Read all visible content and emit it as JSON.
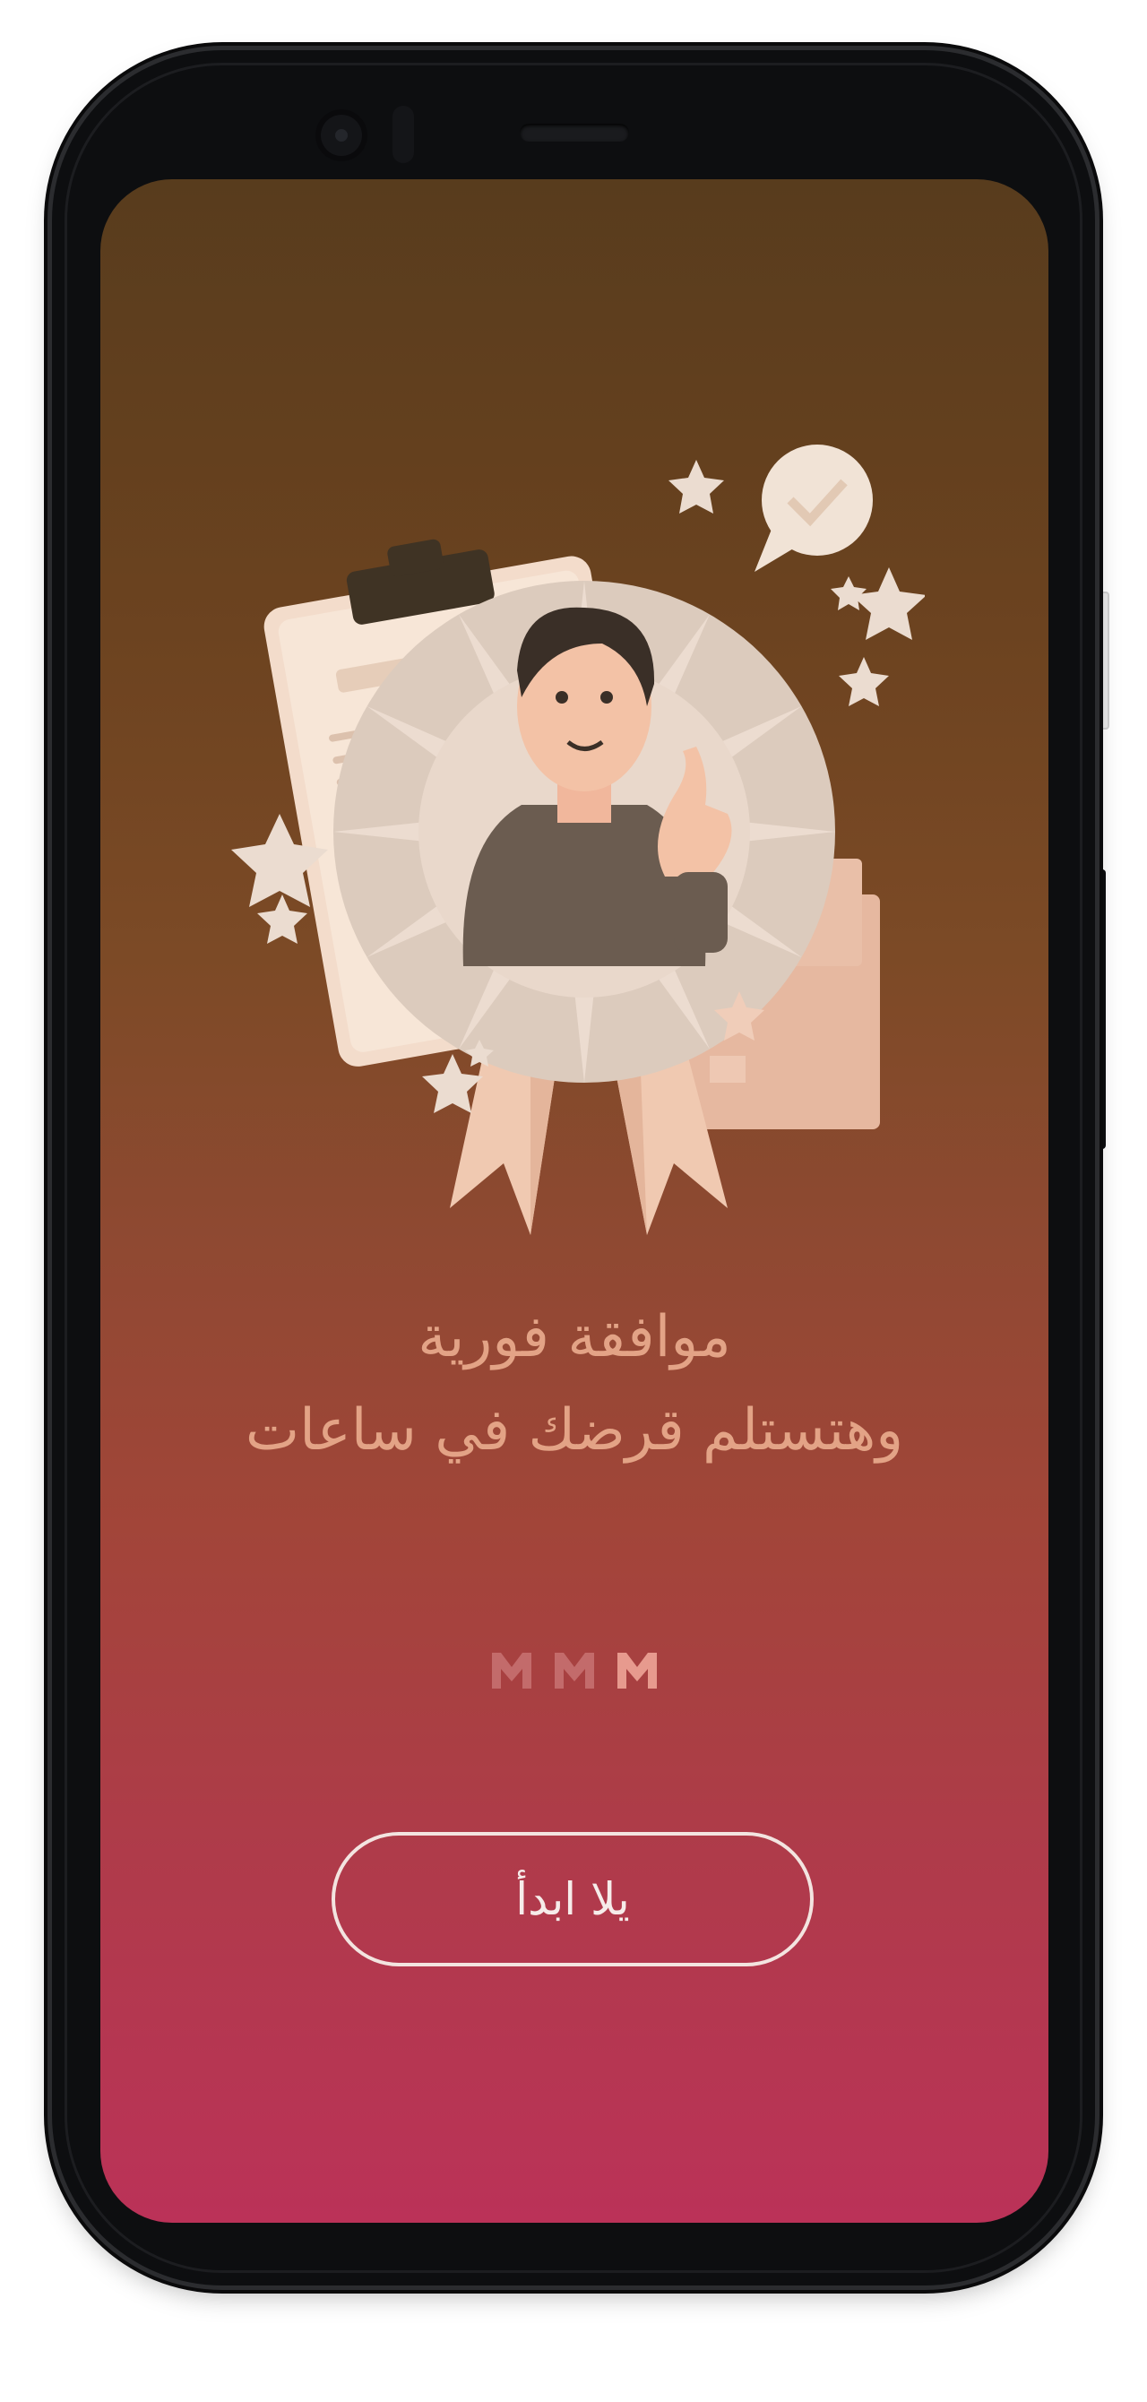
{
  "device": {
    "frame": "phone",
    "colors": {
      "gradient_top": "#583c1d",
      "gradient_bottom": "#bb3258",
      "headline": "#e3a386",
      "button_border": "#f3e4e0"
    }
  },
  "onboarding": {
    "illustration": "approved-man-thumbs-up-badge",
    "headline_line_1": "موافقة فورية",
    "headline_line_2": "وهتستلم قرضك في ساعات",
    "pager": {
      "total": 3,
      "active_index": 2
    },
    "cta_label": "يلا ابدأ"
  }
}
